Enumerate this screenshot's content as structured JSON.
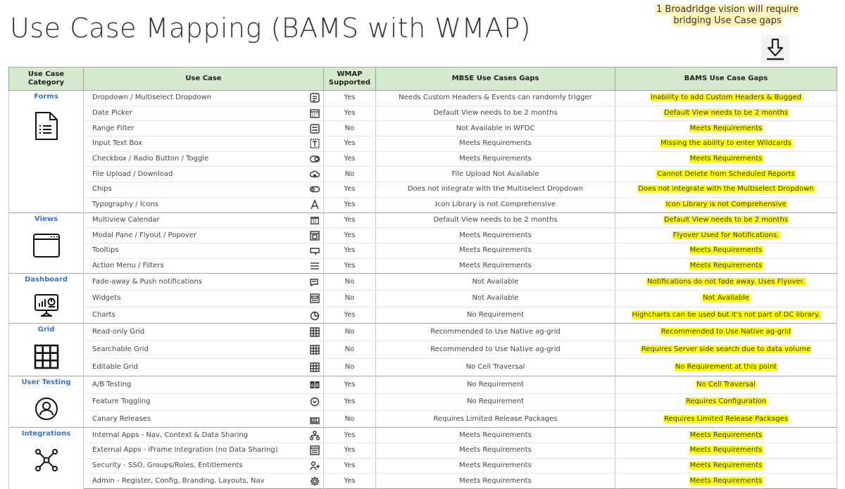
{
  "title": "Use Case Mapping (BAMS with WMAP)",
  "note": {
    "line1": "1 Broadridge vision will require",
    "line2": "bridging Use Case gaps"
  },
  "columns": [
    "Use Case Category",
    "Use Case",
    "WMAP Supported",
    "MBSE Use Cases Gaps",
    "BAMS Use Case Gaps"
  ],
  "colors": {
    "header_bg": "#d6e9cf",
    "category_text": "#3a75c4",
    "highlight": "#ffff00"
  },
  "groups": [
    {
      "category": "Forms",
      "category_icon": "form-document-icon",
      "rows": [
        {
          "use_case": "Dropdown / Multiselect Dropdown",
          "icon": "dropdown-icon",
          "wmap": "Yes",
          "mbse": "Needs Custom Headers & Events can randomly trigger",
          "bams": "Inability to add Custom Headers & Bugged"
        },
        {
          "use_case": "Date Picker",
          "icon": "calendar-icon",
          "wmap": "Yes",
          "mbse": "Default View needs to be 2 months",
          "bams": "Default View needs to be 2 months"
        },
        {
          "use_case": "Range Filter",
          "icon": "range-filter-icon",
          "wmap": "No",
          "mbse": "Not Available in WFDC",
          "bams": "Meets Requirements"
        },
        {
          "use_case": "Input Text Box",
          "icon": "text-box-icon",
          "wmap": "Yes",
          "mbse": "Meets Requirements",
          "bams": "Missing the ability to enter Wildcards"
        },
        {
          "use_case": "Checkbox / Radio Button / Toggle",
          "icon": "toggle-icon",
          "wmap": "Yes",
          "mbse": "Meets Requirements",
          "bams": "Meets Requirements"
        },
        {
          "use_case": "File Upload / Download",
          "icon": "cloud-upload-icon",
          "wmap": "No",
          "mbse": "File Upload Not Available",
          "bams": "Cannot Delete from Scheduled Reports"
        },
        {
          "use_case": "Chips",
          "icon": "chip-icon",
          "wmap": "Yes",
          "mbse": "Does not integrate with the Multiselect Dropdown",
          "bams": "Does not integrate with the Multiselect Dropdown"
        },
        {
          "use_case": "Typography / Icons",
          "icon": "typography-icon",
          "wmap": "Yes",
          "mbse": "Icon Library is not Comprehensive",
          "bams": "Icon Library is not Comprehensive"
        }
      ]
    },
    {
      "category": "Views",
      "category_icon": "browser-window-icon",
      "rows": [
        {
          "use_case": "Multiview Calendar",
          "icon": "multiview-calendar-icon",
          "wmap": "Yes",
          "mbse": "Default View needs to be 2 months",
          "bams": "Default View needs to be 2 months"
        },
        {
          "use_case": "Modal Pane / Flyout / Popover",
          "icon": "modal-icon",
          "wmap": "Yes",
          "mbse": "Meets Requirements",
          "bams": "Flyover Used for Notifications."
        },
        {
          "use_case": "Tooltips",
          "icon": "tooltip-icon",
          "wmap": "Yes",
          "mbse": "Meets Requirements",
          "bams": "Meets Requirements"
        },
        {
          "use_case": "Action Menu / Filters",
          "icon": "menu-icon",
          "wmap": "Yes",
          "mbse": "Meets Requirements",
          "bams": "Meets Requirements"
        }
      ]
    },
    {
      "category": "Dashboard",
      "category_icon": "dashboard-monitor-icon",
      "rows": [
        {
          "use_case": "Fade-away & Push notifications",
          "icon": "notification-icon",
          "wmap": "No",
          "mbse": "Not Available",
          "bams": "Notifications do not fade away. Uses Flyover."
        },
        {
          "use_case": "Widgets",
          "icon": "widget-icon",
          "wmap": "No",
          "mbse": "Not Available",
          "bams": "Not Available"
        },
        {
          "use_case": "Charts",
          "icon": "pie-chart-icon",
          "wmap": "Yes",
          "mbse": "No Requirement",
          "bams": "Highcharts can be used but it's not part of DC library."
        }
      ]
    },
    {
      "category": "Grid",
      "category_icon": "grid-icon",
      "rows": [
        {
          "use_case": "Read-only Grid",
          "icon": "grid-icon",
          "wmap": "No",
          "mbse": "Recommended to Use Native ag-grid",
          "bams": "Recommended to Use Native ag-grid"
        },
        {
          "use_case": "Searchable Grid",
          "icon": "grid-icon",
          "wmap": "No",
          "mbse": "Recommended to Use Native ag-grid",
          "bams": "Requires Server side search due to data volume"
        },
        {
          "use_case": "Editable Grid",
          "icon": "grid-icon",
          "wmap": "No",
          "mbse": "No Cell Traversal",
          "bams": "No Requirement at this point"
        }
      ]
    },
    {
      "category": "User Testing",
      "category_icon": "user-circle-icon",
      "rows": [
        {
          "use_case": "A/B Testing",
          "icon": "ab-test-icon",
          "wmap": "Yes",
          "mbse": "No Requirement",
          "bams": "No Cell Traversal"
        },
        {
          "use_case": "Feature Toggling",
          "icon": "chevron-circle-icon",
          "wmap": "Yes",
          "mbse": "No Requirement",
          "bams": "Requires Configuration"
        },
        {
          "use_case": "Canary Releases",
          "icon": "release-icon",
          "wmap": "No",
          "mbse": "Requires Limited Release Packages",
          "bams": "Requires Limited Release Packages"
        }
      ]
    },
    {
      "category": "Integrations",
      "category_icon": "network-hub-icon",
      "rows": [
        {
          "use_case": "Internal Apps - Nav, Context & Data Sharing",
          "icon": "hierarchy-icon",
          "wmap": "Yes",
          "mbse": "Meets Requirements",
          "bams": "Meets Requirements"
        },
        {
          "use_case": "External Apps - iFrame Integration (no Data Sharing)",
          "icon": "iframe-icon",
          "wmap": "Yes",
          "mbse": "Meets Requirements",
          "bams": "Meets Requirements"
        },
        {
          "use_case": "Security - SSO, Groups/Roles, Entitlements",
          "icon": "user-arrow-icon",
          "wmap": "Yes",
          "mbse": "Meets Requirements",
          "bams": "Meets Requirements"
        },
        {
          "use_case": "Admin - Register, Config, Branding, Layouts, Nav",
          "icon": "gear-icon",
          "wmap": "Yes",
          "mbse": "Meets Requirements",
          "bams": "Meets Requirements"
        }
      ]
    }
  ]
}
